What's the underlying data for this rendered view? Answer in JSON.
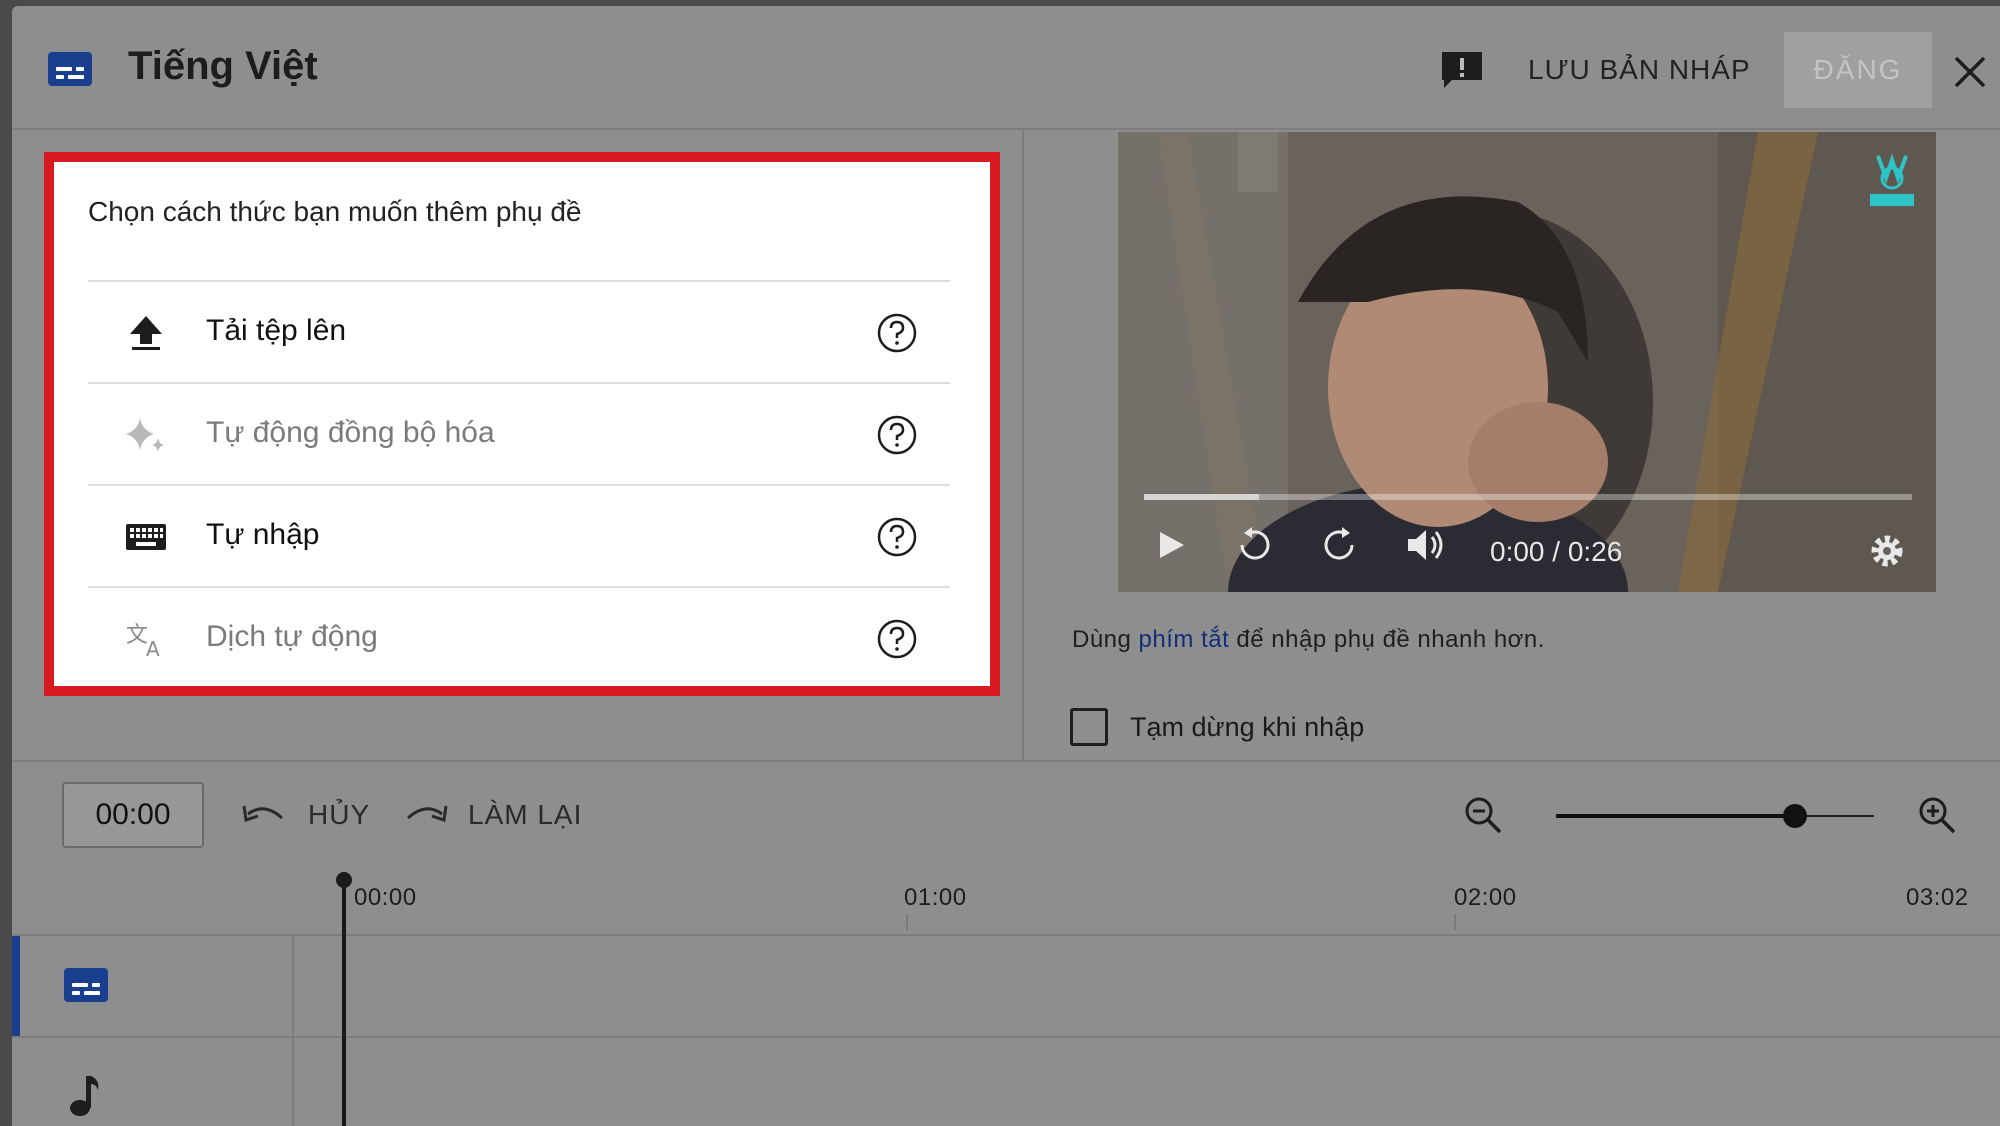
{
  "header": {
    "title": "Tiếng Việt",
    "save_draft_label": "LƯU BẢN NHÁP",
    "publish_label": "ĐĂNG"
  },
  "method_panel": {
    "prompt": "Chọn cách thức bạn muốn thêm phụ đề",
    "options": [
      {
        "label": "Tải tệp lên",
        "icon": "upload-icon",
        "enabled": true
      },
      {
        "label": "Tự động đồng bộ hóa",
        "icon": "sparkle-icon",
        "enabled": false
      },
      {
        "label": "Tự nhập",
        "icon": "keyboard-icon",
        "enabled": true
      },
      {
        "label": "Dịch tự động",
        "icon": "translate-icon",
        "enabled": false
      }
    ]
  },
  "video": {
    "time": "0:00 / 0:26",
    "watermark": "VLIVE"
  },
  "hint": {
    "prefix": "Dùng ",
    "link": "phím tắt",
    "suffix": " để nhập phụ đề nhanh hơn."
  },
  "pause_option": {
    "label": "Tạm dừng khi nhập",
    "checked": false
  },
  "toolbar": {
    "time_value": "00:00",
    "undo_label": "HỦY",
    "redo_label": "LÀM LẠI"
  },
  "timeline": {
    "labels": [
      "00:00",
      "01:00",
      "02:00",
      "03:02"
    ]
  },
  "colors": {
    "highlight_border": "#d71920",
    "accent_blue": "#1b3f8f",
    "link_blue": "#0f2f7a"
  }
}
